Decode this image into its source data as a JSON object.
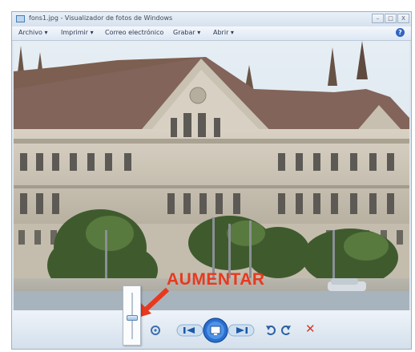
{
  "window": {
    "title": "fons1.jpg - Visualizador de fotos de Windows",
    "min_label": "–",
    "max_label": "□",
    "close_label": "X"
  },
  "menu": {
    "items": [
      "Archivo ▾",
      "Imprimir ▾",
      "Correo electrónico",
      "Grabar ▾",
      "Abrir ▾"
    ],
    "help_label": "?"
  },
  "annotation": {
    "label": "AUMENTAR",
    "color": "#e8391f"
  },
  "zoom": {
    "level": 0.45
  },
  "toolbar": {
    "icons": [
      "zoom-icon",
      "actual-size-icon",
      "previous-icon",
      "slideshow-icon",
      "next-icon",
      "rotate-counterclockwise-icon",
      "rotate-clockwise-icon",
      "delete-icon"
    ],
    "delete_label": "✕"
  }
}
